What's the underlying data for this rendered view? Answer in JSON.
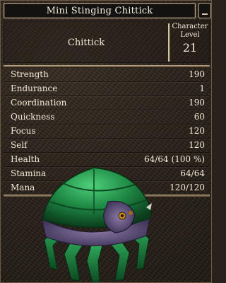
{
  "window": {
    "title": "Mini Stinging Chittick"
  },
  "creature": {
    "name": "Chittick",
    "level_label_line1": "Character",
    "level_label_line2": "Level",
    "level": "21"
  },
  "stats": [
    {
      "label": "Strength",
      "value": "190"
    },
    {
      "label": "Endurance",
      "value": "1"
    },
    {
      "label": "Coordination",
      "value": "190"
    },
    {
      "label": "Quickness",
      "value": "60"
    },
    {
      "label": "Focus",
      "value": "120"
    },
    {
      "label": "Self",
      "value": "120"
    },
    {
      "label": "Health",
      "value": "64/64 (100 %)"
    },
    {
      "label": "Stamina",
      "value": "64/64"
    },
    {
      "label": "Mana",
      "value": "120/120"
    }
  ],
  "icons": {
    "close": "minimize-icon",
    "creature": "chittick-creature-icon"
  },
  "colors": {
    "shell": "#1f8a46",
    "shell_dark": "#0d4a22",
    "body": "#5b4a78",
    "eye": "#c98a1a",
    "panel_text": "#f4ead8"
  }
}
